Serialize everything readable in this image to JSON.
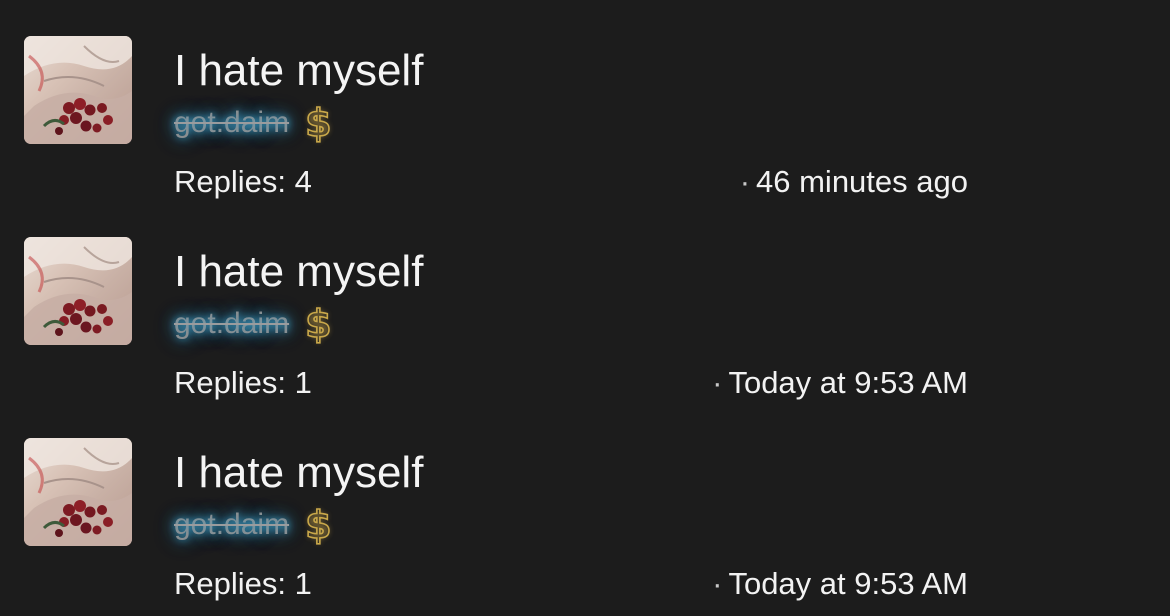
{
  "threads": [
    {
      "title": "I hate myself",
      "author": "got.daim",
      "badge_icon": "dollar-sign-icon",
      "replies": "Replies: 4",
      "separator": "·",
      "time": "46 minutes ago"
    },
    {
      "title": "I hate myself",
      "author": "got.daim",
      "badge_icon": "dollar-sign-icon",
      "replies": "Replies: 1",
      "separator": "·",
      "time": "Today at 9:53 AM"
    },
    {
      "title": "I hate myself",
      "author": "got.daim",
      "badge_icon": "dollar-sign-icon",
      "replies": "Replies: 1",
      "separator": "·",
      "time": "Today at 9:53 AM"
    }
  ],
  "colors": {
    "background": "#1c1c1c",
    "text": "#f2f2f2",
    "username": "#8d8f90",
    "username_glow": "#46aad2",
    "dollar_badge": "#c9a84a"
  }
}
